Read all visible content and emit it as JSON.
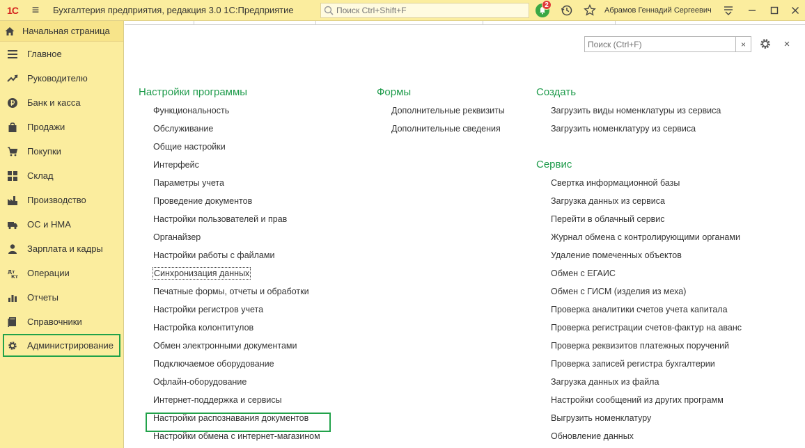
{
  "titlebar": {
    "logo": "1С",
    "title": "Бухгалтерия предприятия, редакция 3.0 1С:Предприятие",
    "search_placeholder": "Поиск Ctrl+Shift+F",
    "notifications_count": "2",
    "user": "Абрамов Геннадий Сергеевич"
  },
  "sidebar": {
    "home": "Начальная страница",
    "items": [
      {
        "label": "Главное",
        "icon": "list-icon"
      },
      {
        "label": "Руководителю",
        "icon": "trend-icon"
      },
      {
        "label": "Банк и касса",
        "icon": "ruble-icon"
      },
      {
        "label": "Продажи",
        "icon": "bag-icon"
      },
      {
        "label": "Покупки",
        "icon": "cart-icon"
      },
      {
        "label": "Склад",
        "icon": "grid-icon"
      },
      {
        "label": "Производство",
        "icon": "factory-icon"
      },
      {
        "label": "ОС и НМА",
        "icon": "truck-icon"
      },
      {
        "label": "Зарплата и кадры",
        "icon": "person-icon"
      },
      {
        "label": "Операции",
        "icon": "dt-kt-icon"
      },
      {
        "label": "Отчеты",
        "icon": "bar-chart-icon"
      },
      {
        "label": "Справочники",
        "icon": "books-icon"
      },
      {
        "label": "Администрирование",
        "icon": "gear-icon"
      }
    ],
    "active_index": 12
  },
  "content": {
    "search_placeholder": "Поиск (Ctrl+F)",
    "clear": "×",
    "close": "×",
    "settings_title": "Настройки программы",
    "settings_links": [
      "Функциональность",
      "Обслуживание",
      "Общие настройки",
      "Интерфейс",
      "Параметры учета",
      "Проведение документов",
      "Настройки пользователей и прав",
      "Органайзер",
      "Настройки работы с файлами",
      "Синхронизация данных",
      "Печатные формы, отчеты и обработки",
      "Настройки регистров учета",
      "Настройка колонтитулов",
      "Обмен электронными документами",
      "Подключаемое оборудование",
      "Офлайн-оборудование",
      "Интернет-поддержка и сервисы",
      "Настройки распознавания документов",
      "Настройки обмена с интернет-магазином"
    ],
    "forms_title": "Формы",
    "forms_links": [
      "Дополнительные реквизиты",
      "Дополнительные сведения"
    ],
    "create_title": "Создать",
    "create_links": [
      "Загрузить виды номенклатуры из сервиса",
      "Загрузить номенклатуру из сервиса"
    ],
    "service_title": "Сервис",
    "service_links": [
      "Свертка информационной базы",
      "Загрузка данных из сервиса",
      "Перейти в облачный сервис",
      "Журнал обмена с контролирующими органами",
      "Удаление помеченных объектов",
      "Обмен с ЕГАИС",
      "Обмен с ГИСМ (изделия из меха)",
      "Проверка аналитики счетов учета капитала",
      "Проверка регистрации счетов-фактур на аванс",
      "Проверка реквизитов платежных поручений",
      "Проверка записей регистра бухгалтерии",
      "Загрузка данных из файла",
      "Настройки сообщений из других программ",
      "Выгрузить номенклатуру",
      "Обновление данных"
    ]
  }
}
